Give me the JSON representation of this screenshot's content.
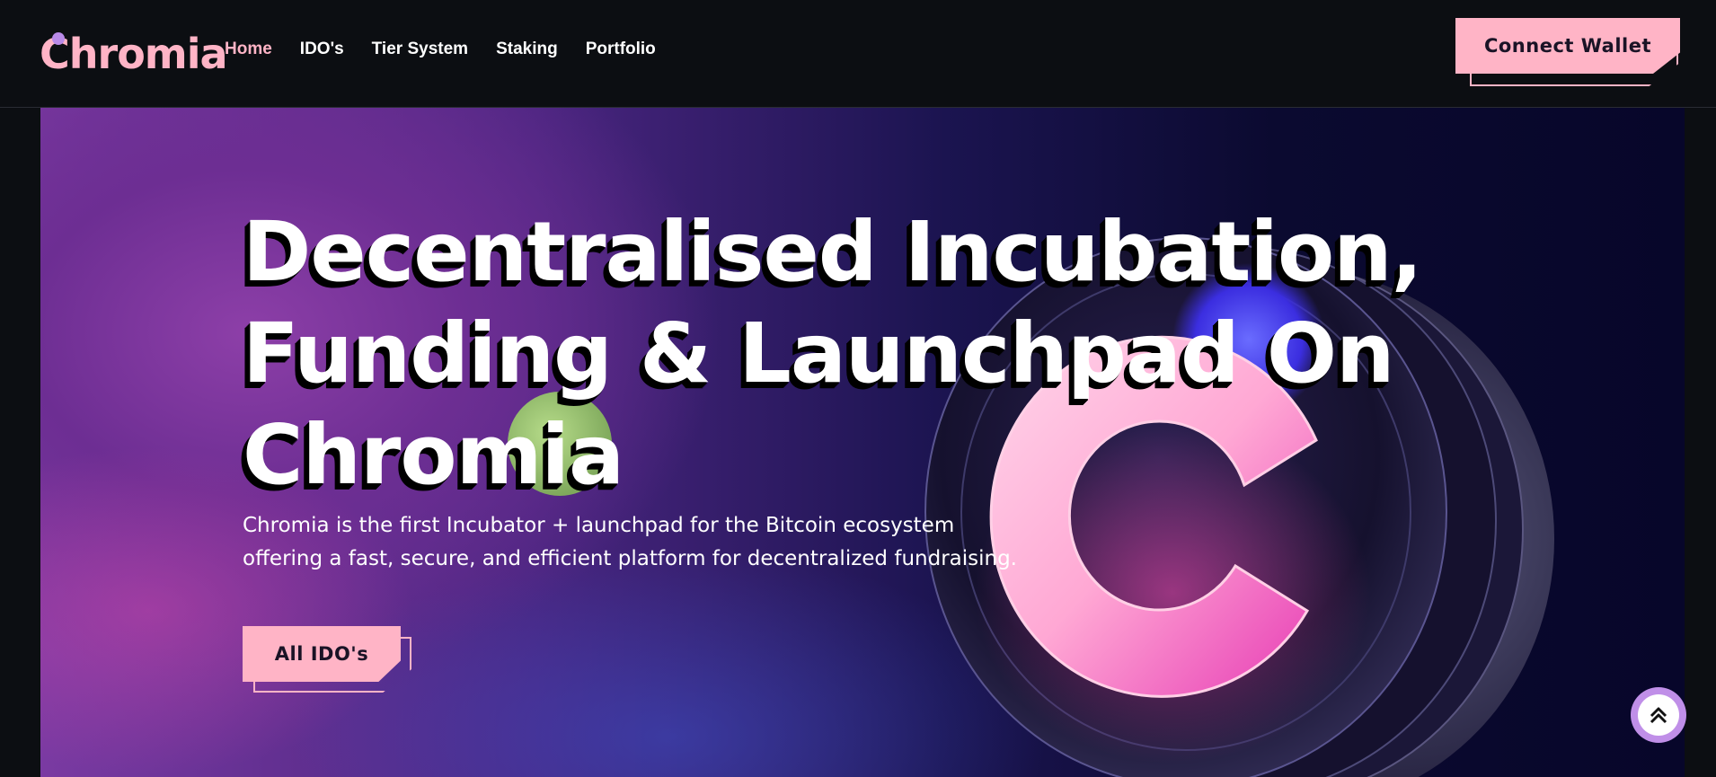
{
  "brand": {
    "logo_text": "Chromia",
    "colors": {
      "accent": "#ffb4c6",
      "background": "#0c0e12",
      "scroll_button": "#c08fe8"
    }
  },
  "nav": {
    "items": [
      {
        "label": "Home",
        "active": true
      },
      {
        "label": "IDO's",
        "active": false
      },
      {
        "label": "Tier System",
        "active": false
      },
      {
        "label": "Staking",
        "active": false
      },
      {
        "label": "Portfolio",
        "active": false
      }
    ]
  },
  "header": {
    "connect_wallet_label": "Connect Wallet"
  },
  "hero": {
    "headline_lines": [
      "Decentralised Incubation,",
      "Funding & Launchpad On",
      "Chromia"
    ],
    "subtitle": "Chromia is the first Incubator + launchpad for the Bitcoin ecosystem offering a fast, secure, and efficient platform for decentralized fundraising.",
    "cta_label": "All IDO's"
  },
  "icons": {
    "scroll_top": "double-chevron-up-icon"
  }
}
